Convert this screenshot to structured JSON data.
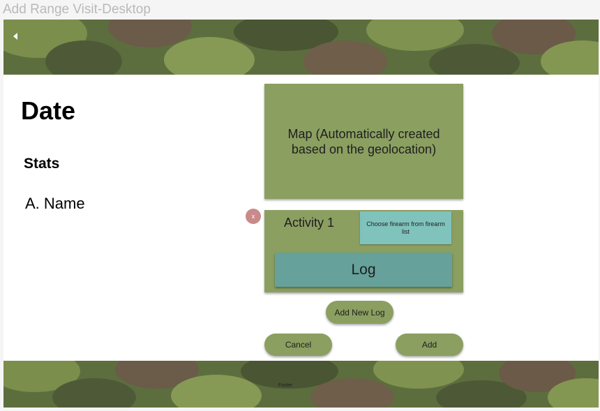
{
  "window": {
    "title": "Add Range Visit-Desktop"
  },
  "header": {
    "back_icon": "chevron-left-icon"
  },
  "left_panel": {
    "date_title": "Date",
    "stats_label": "Stats",
    "name_label": "A. Name"
  },
  "map": {
    "text": "Map (Automatically created based on the geolocation)"
  },
  "activity": {
    "title": "Activity 1",
    "choose_firearm_label": "Choose firearm from firearm list",
    "log_label": "Log",
    "remove_label": "x"
  },
  "actions": {
    "add_new_log_label": "Add New Log",
    "cancel_label": "Cancel",
    "add_label": "Add"
  },
  "footer": {
    "text": "Footer"
  },
  "colors": {
    "camo_base": "#5d6e3e",
    "card_green": "#8b9f61",
    "teal_light": "#80c3bd",
    "teal_dark": "#66a19b",
    "remove_red": "#c98a8a"
  }
}
